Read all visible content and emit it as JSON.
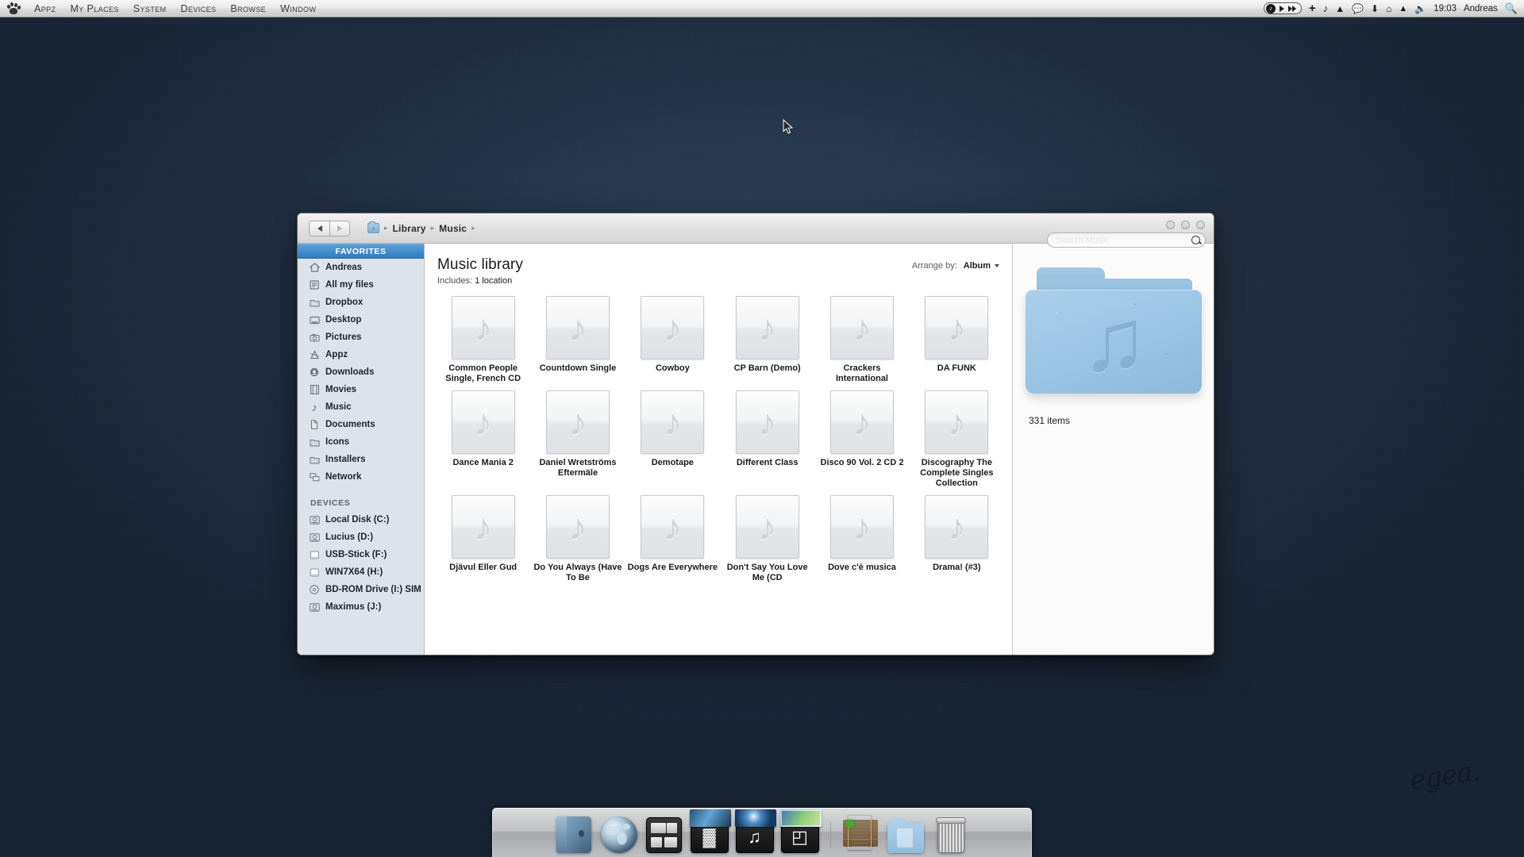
{
  "menubar": {
    "logo_icon": "paw-logo-icon",
    "items": [
      {
        "label": "Appz"
      },
      {
        "label": "My Places"
      },
      {
        "label": "System"
      },
      {
        "label": "Devices"
      },
      {
        "label": "Browse"
      },
      {
        "label": "Window"
      }
    ],
    "status": {
      "player_icon": "music-note-badge-icon",
      "play_icon": "play-icon",
      "forward_icon": "fast-forward-icon",
      "plus_icon": "plus-icon",
      "note_icon": "music-note-icon",
      "caret_icon": "caret-up-icon",
      "chat_icon": "chat-bubble-icon",
      "download_icon": "download-icon",
      "home_icon": "home-icon",
      "eject_icon": "eject-icon",
      "volume_icon": "volume-icon",
      "clock": "19:03",
      "user": "Andreas",
      "search_icon": "spotlight-search-icon"
    }
  },
  "window": {
    "nav": {
      "back_icon": "back-arrow-icon",
      "forward_icon": "forward-arrow-icon"
    },
    "breadcrumb": {
      "folder_icon": "music-folder-icon",
      "items": [
        {
          "label": "Library"
        },
        {
          "label": "Music"
        }
      ],
      "separator": "›"
    },
    "controls": [
      {
        "name": "minimize-button"
      },
      {
        "name": "maximize-button"
      },
      {
        "name": "close-button"
      }
    ],
    "search": {
      "placeholder": "Search Music",
      "value": "",
      "icon": "magnifier-icon"
    }
  },
  "sidebar": {
    "sections": [
      {
        "title": "FAVORITES",
        "items": [
          {
            "label": "Andreas",
            "icon": "home-icon"
          },
          {
            "label": "All my files",
            "icon": "all-files-icon"
          },
          {
            "label": "Dropbox",
            "icon": "folder-icon"
          },
          {
            "label": "Desktop",
            "icon": "desktop-icon"
          },
          {
            "label": "Pictures",
            "icon": "camera-icon"
          },
          {
            "label": "Appz",
            "icon": "applications-icon"
          },
          {
            "label": "Downloads",
            "icon": "download-circle-icon"
          },
          {
            "label": "Movies",
            "icon": "film-icon"
          },
          {
            "label": "Music",
            "icon": "music-note-icon"
          },
          {
            "label": "Documents",
            "icon": "documents-icon"
          },
          {
            "label": "Icons",
            "icon": "folder-icon"
          },
          {
            "label": "Installers",
            "icon": "folder-icon"
          },
          {
            "label": "Network",
            "icon": "network-icon"
          }
        ]
      },
      {
        "title": "DEVICES",
        "items": [
          {
            "label": "Local Disk (C:)",
            "icon": "hard-drive-icon"
          },
          {
            "label": "Lucius (D:)",
            "icon": "hard-drive-icon"
          },
          {
            "label": "USB-Stick (F:)",
            "icon": "removable-drive-icon"
          },
          {
            "label": "WIN7X64 (H:)",
            "icon": "removable-drive-icon"
          },
          {
            "label": "BD-ROM Drive (I:) SIM",
            "icon": "optical-disc-icon"
          },
          {
            "label": "Maximus (J:)",
            "icon": "hard-drive-icon"
          }
        ]
      }
    ]
  },
  "main": {
    "title": "Music library",
    "includes_label": "Includes:",
    "includes_value": "1 location",
    "arrange_label": "Arrange by:",
    "arrange_value": "Album",
    "items": [
      {
        "label": "Common People Single, French CD",
        "icon": "music-album-icon"
      },
      {
        "label": "Countdown Single",
        "icon": "music-album-icon"
      },
      {
        "label": "Cowboy",
        "icon": "music-album-icon"
      },
      {
        "label": "CP Barn (Demo)",
        "icon": "music-album-icon"
      },
      {
        "label": "Crackers International",
        "icon": "music-album-icon"
      },
      {
        "label": "DA FUNK",
        "icon": "music-album-icon"
      },
      {
        "label": "Dance Mania 2",
        "icon": "music-album-icon"
      },
      {
        "label": "Daniel Wretströms Eftermäle",
        "icon": "music-album-icon"
      },
      {
        "label": "Demotape",
        "icon": "music-album-icon"
      },
      {
        "label": "Different Class",
        "icon": "music-album-icon"
      },
      {
        "label": "Disco 90 Vol. 2 CD 2",
        "icon": "music-album-icon"
      },
      {
        "label": "Discography The Complete Singles Collection",
        "icon": "music-album-icon"
      },
      {
        "label": "Djävul Eller Gud",
        "icon": "music-album-icon"
      },
      {
        "label": "Do You Always (Have To Be",
        "icon": "music-album-icon"
      },
      {
        "label": "Dogs Are Everywhere",
        "icon": "music-album-icon"
      },
      {
        "label": "Don't Say You Love Me (CD",
        "icon": "music-album-icon"
      },
      {
        "label": "Dove c'è musica",
        "icon": "music-album-icon"
      },
      {
        "label": "Drama! (#3)",
        "icon": "music-album-icon"
      }
    ],
    "note_glyph": "♪"
  },
  "preview": {
    "folder_icon": "music-folder-large-icon",
    "note_glyph": "♫",
    "item_count": "331 items"
  },
  "dock": {
    "items": [
      {
        "name": "finder",
        "icon": "finder-icon"
      },
      {
        "name": "browser",
        "icon": "globe-icon"
      },
      {
        "name": "system-preferences",
        "icon": "system-preferences-icon"
      },
      {
        "name": "movies-stack",
        "icon": "film-stack-icon",
        "glyph": "▓"
      },
      {
        "name": "music-stack",
        "icon": "music-stack-icon",
        "glyph": "♫"
      },
      {
        "name": "photos-stack",
        "icon": "photos-stack-icon",
        "glyph": "◰"
      },
      {
        "name": "documents-stack",
        "icon": "documents-stack-icon"
      },
      {
        "name": "downloads-folder",
        "icon": "folder-icon"
      },
      {
        "name": "trash",
        "icon": "trash-icon"
      }
    ]
  },
  "desktop": {
    "watermark": "egea."
  }
}
